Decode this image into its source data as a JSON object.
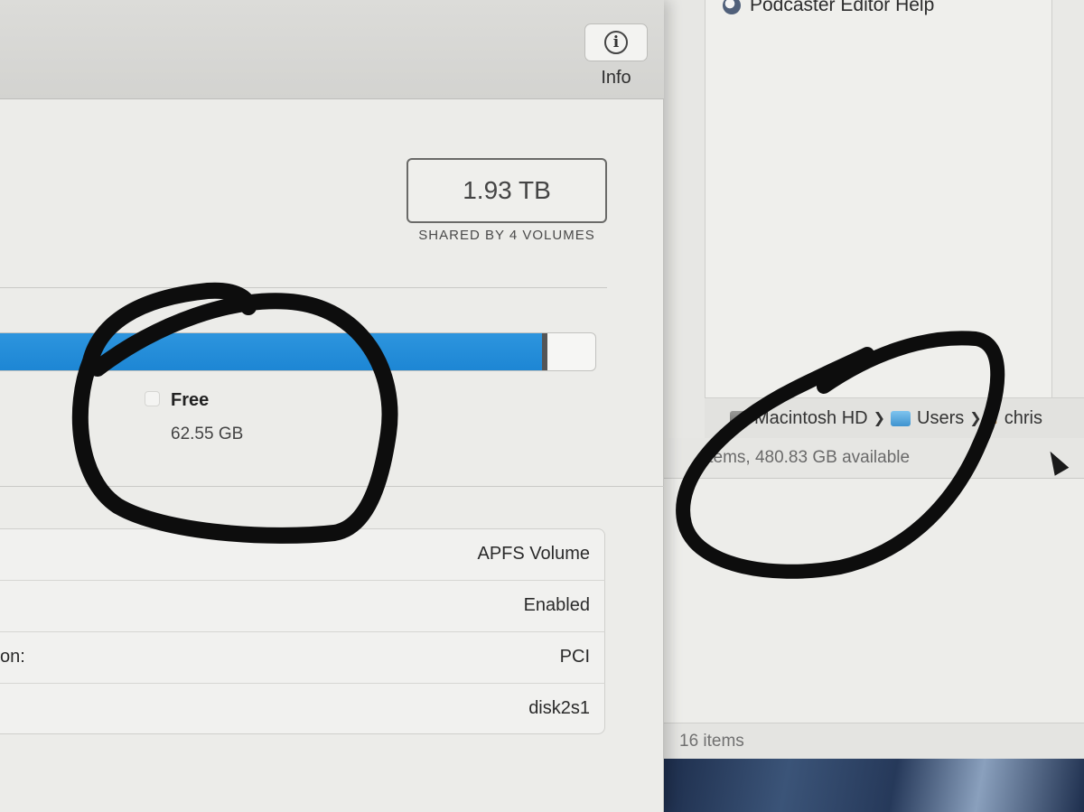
{
  "finder": {
    "list_item": "Podcaster Editor Help",
    "path": [
      {
        "icon": "disk-icon",
        "label": "Macintosh HD"
      },
      {
        "icon": "folder-icon",
        "label": "Users"
      },
      {
        "icon": "home-icon",
        "label": "chris"
      }
    ],
    "status": "items, 480.83 GB available",
    "items_count": "16 items"
  },
  "disk_utility": {
    "toolbar": {
      "info_label": "Info",
      "info_icon": "info-circle-icon"
    },
    "capacity": {
      "value": "1.93 TB",
      "caption": "SHARED BY 4 VOLUMES"
    },
    "usage": {
      "used_fraction": 0.92,
      "used_color": "#1d86d4"
    },
    "legend": {
      "free_label": "Free",
      "free_value": "62.55 GB"
    },
    "details": [
      {
        "key": "",
        "value": "APFS Volume"
      },
      {
        "key": "",
        "value": "Enabled"
      },
      {
        "key": "on:",
        "value": "PCI"
      },
      {
        "key": "",
        "value": "disk2s1"
      }
    ]
  }
}
